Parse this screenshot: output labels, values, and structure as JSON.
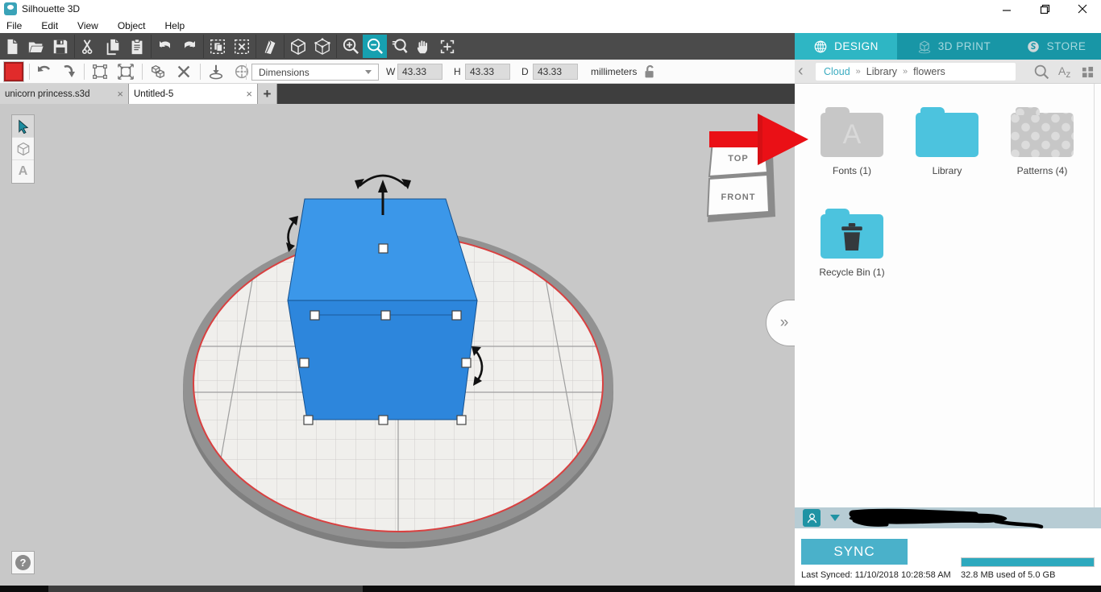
{
  "window": {
    "title": "Silhouette 3D"
  },
  "menu": {
    "items": [
      "File",
      "Edit",
      "View",
      "Object",
      "Help"
    ]
  },
  "toolbar": {
    "active_tool": "zoom-out"
  },
  "props": {
    "dropdown_value": "Dimensions",
    "w_label": "W",
    "w_value": "43.33",
    "h_label": "H",
    "h_value": "43.33",
    "d_label": "D",
    "d_value": "43.33",
    "units": "millimeters"
  },
  "tabs": {
    "tab1": "unicorn princess.s3d",
    "tab2": "Untitled-5",
    "close": "×",
    "add": "+"
  },
  "viewport": {
    "view_top": "TOP",
    "view_front": "FRONT",
    "help": "?",
    "collapse": "»"
  },
  "panel": {
    "tab_design": "DESIGN",
    "tab_print": "3D PRINT",
    "tab_store": "STORE",
    "crumb_cloud": "Cloud",
    "crumb_sep": "»",
    "crumb_library": "Library",
    "crumb_flowers": "flowers",
    "sort_a": "A",
    "sort_z": "z",
    "folders": [
      {
        "label": "Fonts (1)"
      },
      {
        "label": "Library"
      },
      {
        "label": "Patterns (4)"
      },
      {
        "label": "Recycle Bin (1)"
      }
    ],
    "sync_button": "SYNC",
    "last_synced": "Last Synced: 11/10/2018 10:28:58 AM",
    "storage": "32.8 MB used of 5.0 GB"
  },
  "colors": {
    "teal_header": "#1896a6",
    "teal_active": "#2eb6c4",
    "cube_blue": "#2d86dc",
    "annotation_red": "#ea1016"
  }
}
